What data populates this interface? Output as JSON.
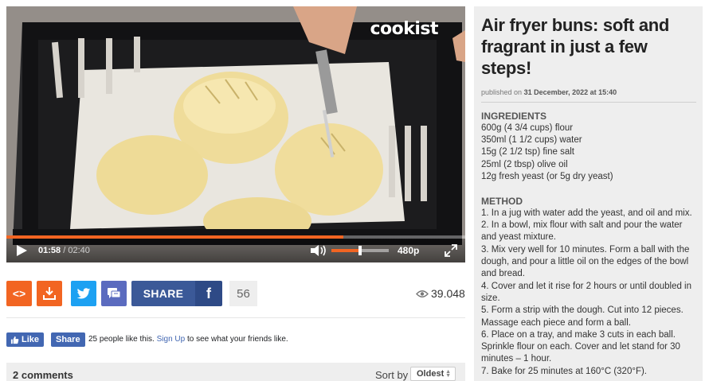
{
  "player": {
    "brand": "cookist",
    "progress": 0.735,
    "current_time": "01:58",
    "separator": "/",
    "duration": "02:40",
    "volume": 0.5,
    "quality": "480p"
  },
  "actions": {
    "embed_label": "<>",
    "share_label": "SHARE",
    "facebook_label": "f",
    "share_count": "56",
    "views": "39.048"
  },
  "facebook": {
    "like_label": "Like",
    "share_label": "Share",
    "text_before": "25 people like this.",
    "signup_link": "Sign Up",
    "text_after": "to see what your friends like."
  },
  "comments": {
    "count_label": "2 comments",
    "sort_label": "Sort by",
    "sort_value": "Oldest"
  },
  "article": {
    "title": "Air fryer buns: soft and fragrant in just a few steps!",
    "published_prefix": "published on",
    "published_date": "31 December, 2022 at 15:40",
    "ingredients_heading": "INGREDIENTS",
    "ingredients": [
      "600g (4 3/4 cups) flour",
      "350ml (1 1/2 cups) water",
      "15g (2 1/2 tsp) fine salt",
      "25ml (2 tbsp) olive oil",
      "12g fresh yeast (or 5g dry yeast)"
    ],
    "method_heading": "METHOD",
    "method_lines": [
      "1. In a jug with water add the yeast, and oil and mix.",
      "2. In a bowl, mix flour with salt and pour the water",
      "and yeast mixture.",
      "3. Mix very well for 10 minutes. Form a ball with the",
      "dough, and pour a little oil on the edges of the bowl",
      "and bread.",
      "4. Cover and let it rise for 2 hours or until doubled in",
      "size.",
      "5. Form a strip with the dough. Cut into 12 pieces.",
      "Massage each piece and form a ball.",
      "6. Place on a tray, and make 3 cuts in each ball.",
      "Sprinkle flour on each. Cover and let stand for 30",
      "minutes – 1 hour.",
      "7. Bake for 25 minutes at 160°C (320°F)."
    ]
  },
  "colors": {
    "accent_orange": "#f26522",
    "twitter_blue": "#1da1f2",
    "facebook_blue": "#3b5998",
    "comment_purple": "#5b6bbf"
  }
}
